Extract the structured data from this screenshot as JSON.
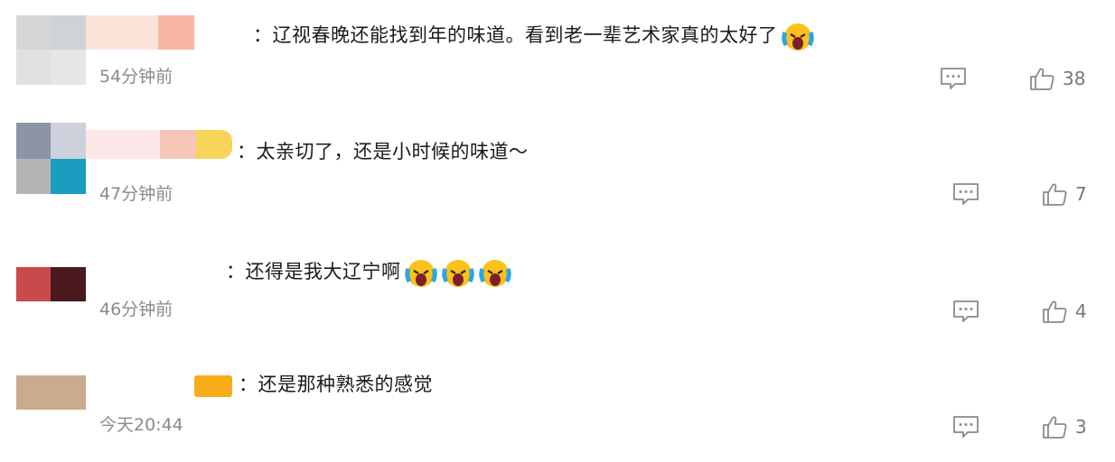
{
  "comments": [
    {
      "text": "：辽视春晚还能找到年的味道。看到老一辈艺术家真的太好了",
      "emoji_count": 1,
      "emoji_icon": "screaming-face-emoji",
      "time": "54分钟前",
      "likes": "38",
      "avatar_colors": [
        "#d8d8d8",
        "#cfd3d6",
        "#e2e2e2",
        "#e4e4e4"
      ],
      "name_colors": [
        "#fad6c6",
        "#f7b9a4"
      ]
    },
    {
      "text": "：太亲切了，还是小时候的味道～",
      "emoji_count": 0,
      "time": "47分钟前",
      "likes": "7",
      "avatar_colors": [
        "#8d94a6",
        "#ccd1dc",
        "#b8b8b8",
        "#1a9dc0"
      ],
      "name_colors": [
        "#fbe3e3",
        "#f5c1b4",
        "#f7d55e"
      ]
    },
    {
      "text": "：还得是我大辽宁啊",
      "emoji_count": 3,
      "emoji_icon": "screaming-face-emoji",
      "time": "46分钟前",
      "likes": "4",
      "avatar_colors": [
        "#c84a4a",
        "#4a1a1f"
      ],
      "name_colors": []
    },
    {
      "text": "：还是那种熟悉的感觉",
      "emoji_count": 0,
      "time": "今天20:44",
      "likes": "3",
      "avatar_colors": [
        "#c9ab8f"
      ],
      "name_colors": [
        "#f8ad18"
      ]
    }
  ],
  "colors": {
    "text": "#1a1a1a",
    "time": "#8a8a8a",
    "icon": "#8a8a8a"
  }
}
